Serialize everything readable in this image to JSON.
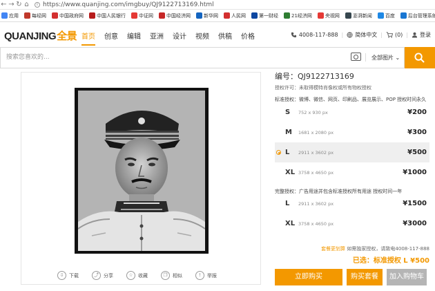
{
  "browser": {
    "url": "https://www.quanjing.com/imgbuy/QJ9122713169.html",
    "bookmarks": [
      {
        "label": "应用",
        "color": "#4285f4"
      },
      {
        "label": "每经网",
        "color": "#c0392b"
      },
      {
        "label": "中国政府网",
        "color": "#d32f2f"
      },
      {
        "label": "中国人民银行",
        "color": "#b71c1c"
      },
      {
        "label": "中证网",
        "color": "#e53935"
      },
      {
        "label": "中国经济网",
        "color": "#c62828"
      },
      {
        "label": "新华网",
        "color": "#1565c0"
      },
      {
        "label": "人民网",
        "color": "#d32f2f"
      },
      {
        "label": "第一财经",
        "color": "#0d47a1"
      },
      {
        "label": "21经济网",
        "color": "#2e7d32"
      },
      {
        "label": "央视网",
        "color": "#e53935"
      },
      {
        "label": "澎湃新闻",
        "color": "#37474f"
      },
      {
        "label": "百度",
        "color": "#1e88e5"
      },
      {
        "label": "后台管理系统",
        "color": "#1976d2"
      }
    ]
  },
  "header": {
    "logo_latin": "QUANJING",
    "logo_cn": "全景",
    "nav": [
      {
        "label": "首页",
        "active": true
      },
      {
        "label": "创意",
        "active": false
      },
      {
        "label": "编辑",
        "active": false
      },
      {
        "label": "亚洲",
        "active": false
      },
      {
        "label": "设计",
        "active": false
      },
      {
        "label": "视频",
        "active": false
      },
      {
        "label": "供稿",
        "active": false
      },
      {
        "label": "价格",
        "active": false
      }
    ],
    "phone": "4008-117-888",
    "language": "简体中文",
    "cart": "(0)",
    "login": "登录"
  },
  "search": {
    "placeholder": "搜索您喜欢的...",
    "category": "全部图片"
  },
  "image": {
    "tools": [
      "下载",
      "分享",
      "收藏",
      "相似",
      "举报"
    ]
  },
  "product": {
    "code": "编号：QJ9122713169",
    "permit": "授权许可：未取得模特肖像权或所有物权授权",
    "standard_label": "标准授权：微博、微信、网页、印刷品、展览展示、POP 授权时间永久",
    "standard_sizes": [
      {
        "label": "S",
        "dims": "752 x 930 px",
        "price": "¥200",
        "selected": false
      },
      {
        "label": "M",
        "dims": "1681 x 2080 px",
        "price": "¥300",
        "selected": false
      },
      {
        "label": "L",
        "dims": "2911 x 3602 px",
        "price": "¥500",
        "selected": true
      },
      {
        "label": "XL",
        "dims": "3758 x 4650 px",
        "price": "¥1000",
        "selected": false
      }
    ],
    "full_label": "完整授权：广告用途并包含标准授权所有用途 授权时间一年",
    "full_sizes": [
      {
        "label": "L",
        "dims": "2911 x 3602 px",
        "price": "¥1500",
        "selected": false
      },
      {
        "label": "XL",
        "dims": "3758 x 4650 px",
        "price": "¥3000",
        "selected": false
      }
    ],
    "hint_tag": "套餐更划算",
    "hint_text": "如需独家授权，请致电4008-117-888",
    "chosen": "已选：标准授权 L ¥500",
    "buy_label": "立即购买",
    "bundle_label": "购买套餐",
    "cart_label": "加入购物车"
  }
}
